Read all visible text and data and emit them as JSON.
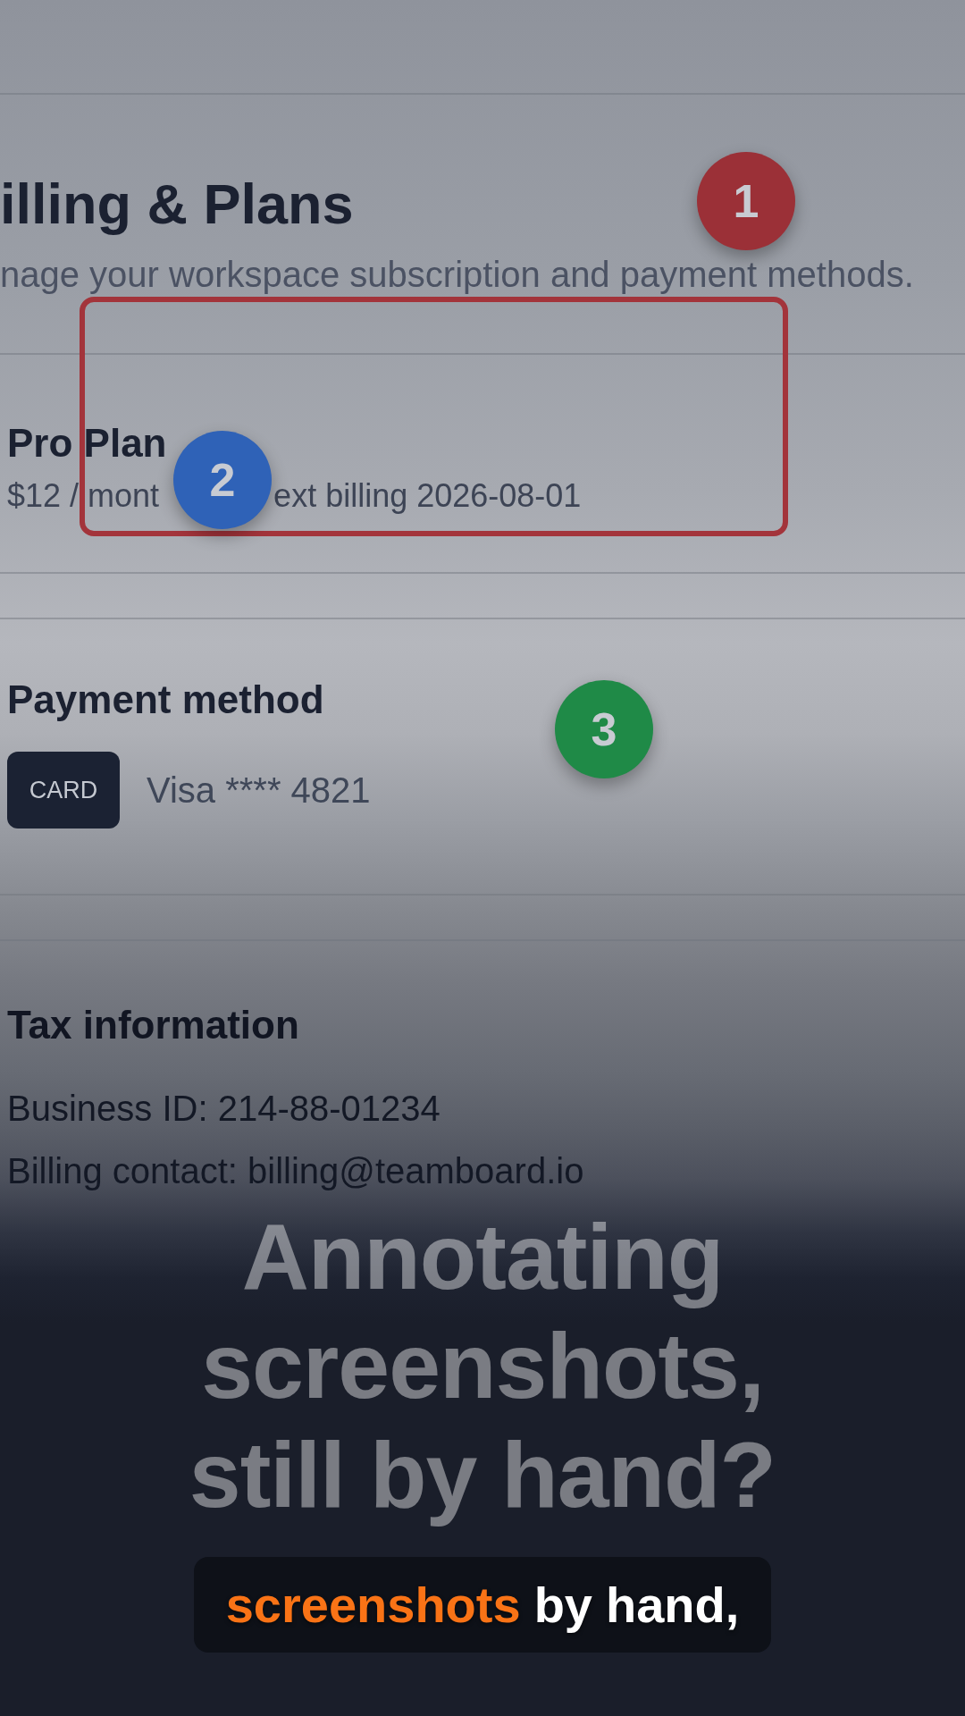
{
  "page": {
    "title": "illing & Plans",
    "subtitle": "nage your workspace subscription and payment methods."
  },
  "plan": {
    "name": "Pro Plan",
    "details": [
      "$12 / mont",
      "ext billing 2026-08-01"
    ]
  },
  "payment": {
    "heading": "Payment method",
    "card_badge": "CARD",
    "card": "Visa **** 4821"
  },
  "tax": {
    "heading": "Tax information",
    "lines": [
      "Business ID: 214-88-01234",
      "Billing contact: billing@teamboard.io"
    ]
  },
  "annotations": {
    "markers": [
      {
        "number": "1",
        "color": "#9b3037"
      },
      {
        "number": "2",
        "color": "#2f62b7"
      },
      {
        "number": "3",
        "color": "#1f8a47"
      }
    ]
  },
  "overlay_title": "Annotating screenshots, still by hand?",
  "caption": {
    "words": [
      {
        "text": "screenshots",
        "highlighted": true
      },
      {
        "text": "by",
        "highlighted": false
      },
      {
        "text": "hand,",
        "highlighted": false
      }
    ]
  }
}
